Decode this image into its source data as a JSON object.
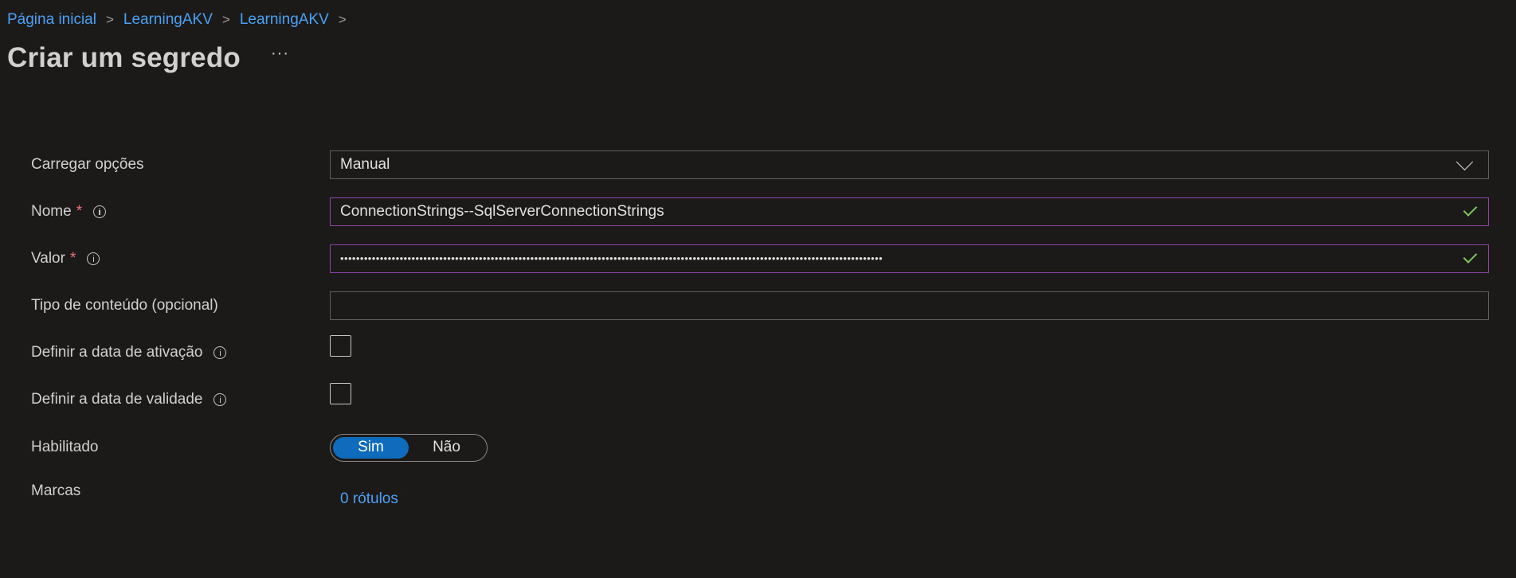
{
  "breadcrumb": {
    "items": [
      {
        "label": "Página inicial"
      },
      {
        "label": "LearningAKV"
      },
      {
        "label": "LearningAKV"
      }
    ],
    "separator": ">"
  },
  "header": {
    "title": "Criar um segredo",
    "more_label": "···"
  },
  "form": {
    "upload": {
      "label": "Carregar opções",
      "value": "Manual"
    },
    "name": {
      "label": "Nome",
      "required_mark": "*",
      "value": "ConnectionStrings--SqlServerConnectionStrings"
    },
    "value": {
      "label": "Valor",
      "required_mark": "*",
      "masked_value": "•••••••••••••••••••••••••••••••••••••••••••••••••••••••••••••••••••••••••••••••••••••••••••••••••••••••••••••••••••••••••••••••••••••••••"
    },
    "content_type": {
      "label": "Tipo de conteúdo (opcional)",
      "value": ""
    },
    "activation": {
      "label": "Definir a data de ativação",
      "checked": false
    },
    "expiration": {
      "label": "Definir a data de validade",
      "checked": false
    },
    "enabled": {
      "label": "Habilitado",
      "options": [
        "Sim",
        "Não"
      ],
      "selected": "Sim"
    },
    "tags": {
      "label": "Marcas",
      "link": "0 rótulos"
    }
  },
  "colors": {
    "background": "#1b1a19",
    "link": "#4aa0f5",
    "valid_border": "#8b42a9",
    "valid_check": "#7cc261",
    "toggle_selected": "#0f6cbd",
    "required": "#f1707b"
  }
}
